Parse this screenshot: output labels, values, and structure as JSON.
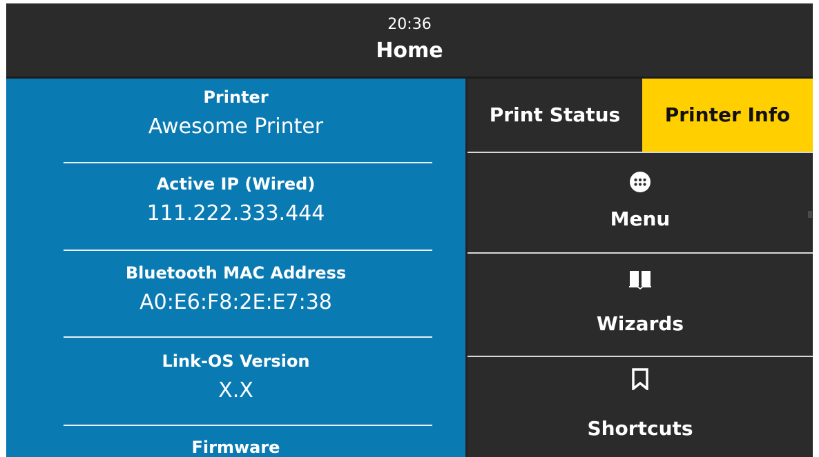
{
  "header": {
    "time": "20:36",
    "title": "Home"
  },
  "info": {
    "items": [
      {
        "label": "Printer",
        "value": "Awesome Printer"
      },
      {
        "label": "Active IP (Wired)",
        "value": "111.222.333.444"
      },
      {
        "label": "Bluetooth MAC Address",
        "value": "A0:E6:F8:2E:E7:38"
      },
      {
        "label": "Link-OS Version",
        "value": "X.X"
      },
      {
        "label": "Firmware",
        "value": ""
      }
    ]
  },
  "tabs": {
    "print_status": "Print Status",
    "printer_info": "Printer Info",
    "active": "printer_info"
  },
  "nav": {
    "menu": {
      "label": "Menu",
      "icon": "menu-dots-icon"
    },
    "wizards": {
      "label": "Wizards",
      "icon": "book-icon"
    },
    "shortcuts": {
      "label": "Shortcuts",
      "icon": "bookmark-icon"
    }
  },
  "colors": {
    "header_bg": "#2b2b2b",
    "info_bg": "#0a7ab3",
    "active_tab_bg": "#ffcf00",
    "panel_bg": "#2b2b2b"
  }
}
